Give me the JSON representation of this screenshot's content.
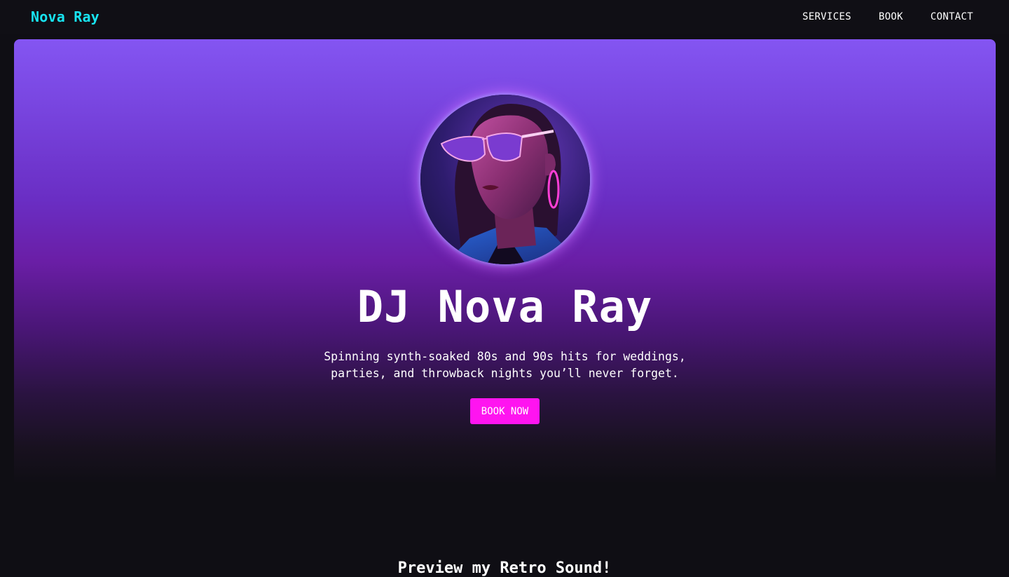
{
  "header": {
    "brand": "Nova Ray",
    "nav": [
      {
        "label": "SERVICES"
      },
      {
        "label": "BOOK"
      },
      {
        "label": "CONTACT"
      }
    ]
  },
  "hero": {
    "title": "DJ Nova Ray",
    "tagline": "Spinning synth-soaked 80s and 90s hits for weddings, parties, and throwback nights you’ll never forget.",
    "cta_label": "BOOK NOW",
    "avatar_icon": "portrait-photo"
  },
  "preview": {
    "heading": "Preview my Retro Sound!"
  },
  "colors": {
    "brand": "#18e3f0",
    "accent": "#ff14f0",
    "background": "#0f0e14",
    "hero_top": "#8455f2",
    "hero_mid": "#6a1ea6"
  }
}
